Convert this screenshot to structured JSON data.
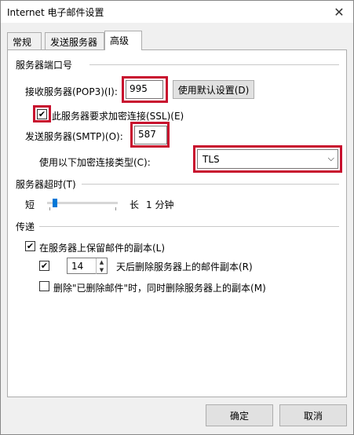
{
  "window": {
    "title": "Internet 电子邮件设置"
  },
  "tabs": [
    {
      "label": "常规"
    },
    {
      "label": "发送服务器"
    },
    {
      "label": "高级"
    }
  ],
  "ports": {
    "section": "服务器端口号",
    "incoming_label": "接收服务器(POP3)(I):",
    "incoming_value": "995",
    "default_button": "使用默认设置(D)",
    "ssl_label": "此服务器要求加密连接(SSL)(E)",
    "ssl_checked": true,
    "outgoing_label": "发送服务器(SMTP)(O):",
    "outgoing_value": "587",
    "encryption_label": "使用以下加密连接类型(C):",
    "encryption_value": "TLS"
  },
  "timeout": {
    "section": "服务器超时(T)",
    "short_label": "短",
    "long_label": "长",
    "value_text": "1 分钟",
    "level": 0.08
  },
  "delivery": {
    "section": "传递",
    "keep_copy_label": "在服务器上保留邮件的副本(L)",
    "keep_copy_checked": true,
    "remove_after_checked": true,
    "remove_after_days": "14",
    "remove_after_label": "天后删除服务器上的邮件副本(R)",
    "remove_deleted_label": "删除\"已删除邮件\"时，同时删除服务器上的副本(M)",
    "remove_deleted_checked": false
  },
  "footer": {
    "ok": "确定",
    "cancel": "取消"
  },
  "colors": {
    "highlight_border": "#c8102e",
    "slider_thumb": "#0078d7"
  }
}
